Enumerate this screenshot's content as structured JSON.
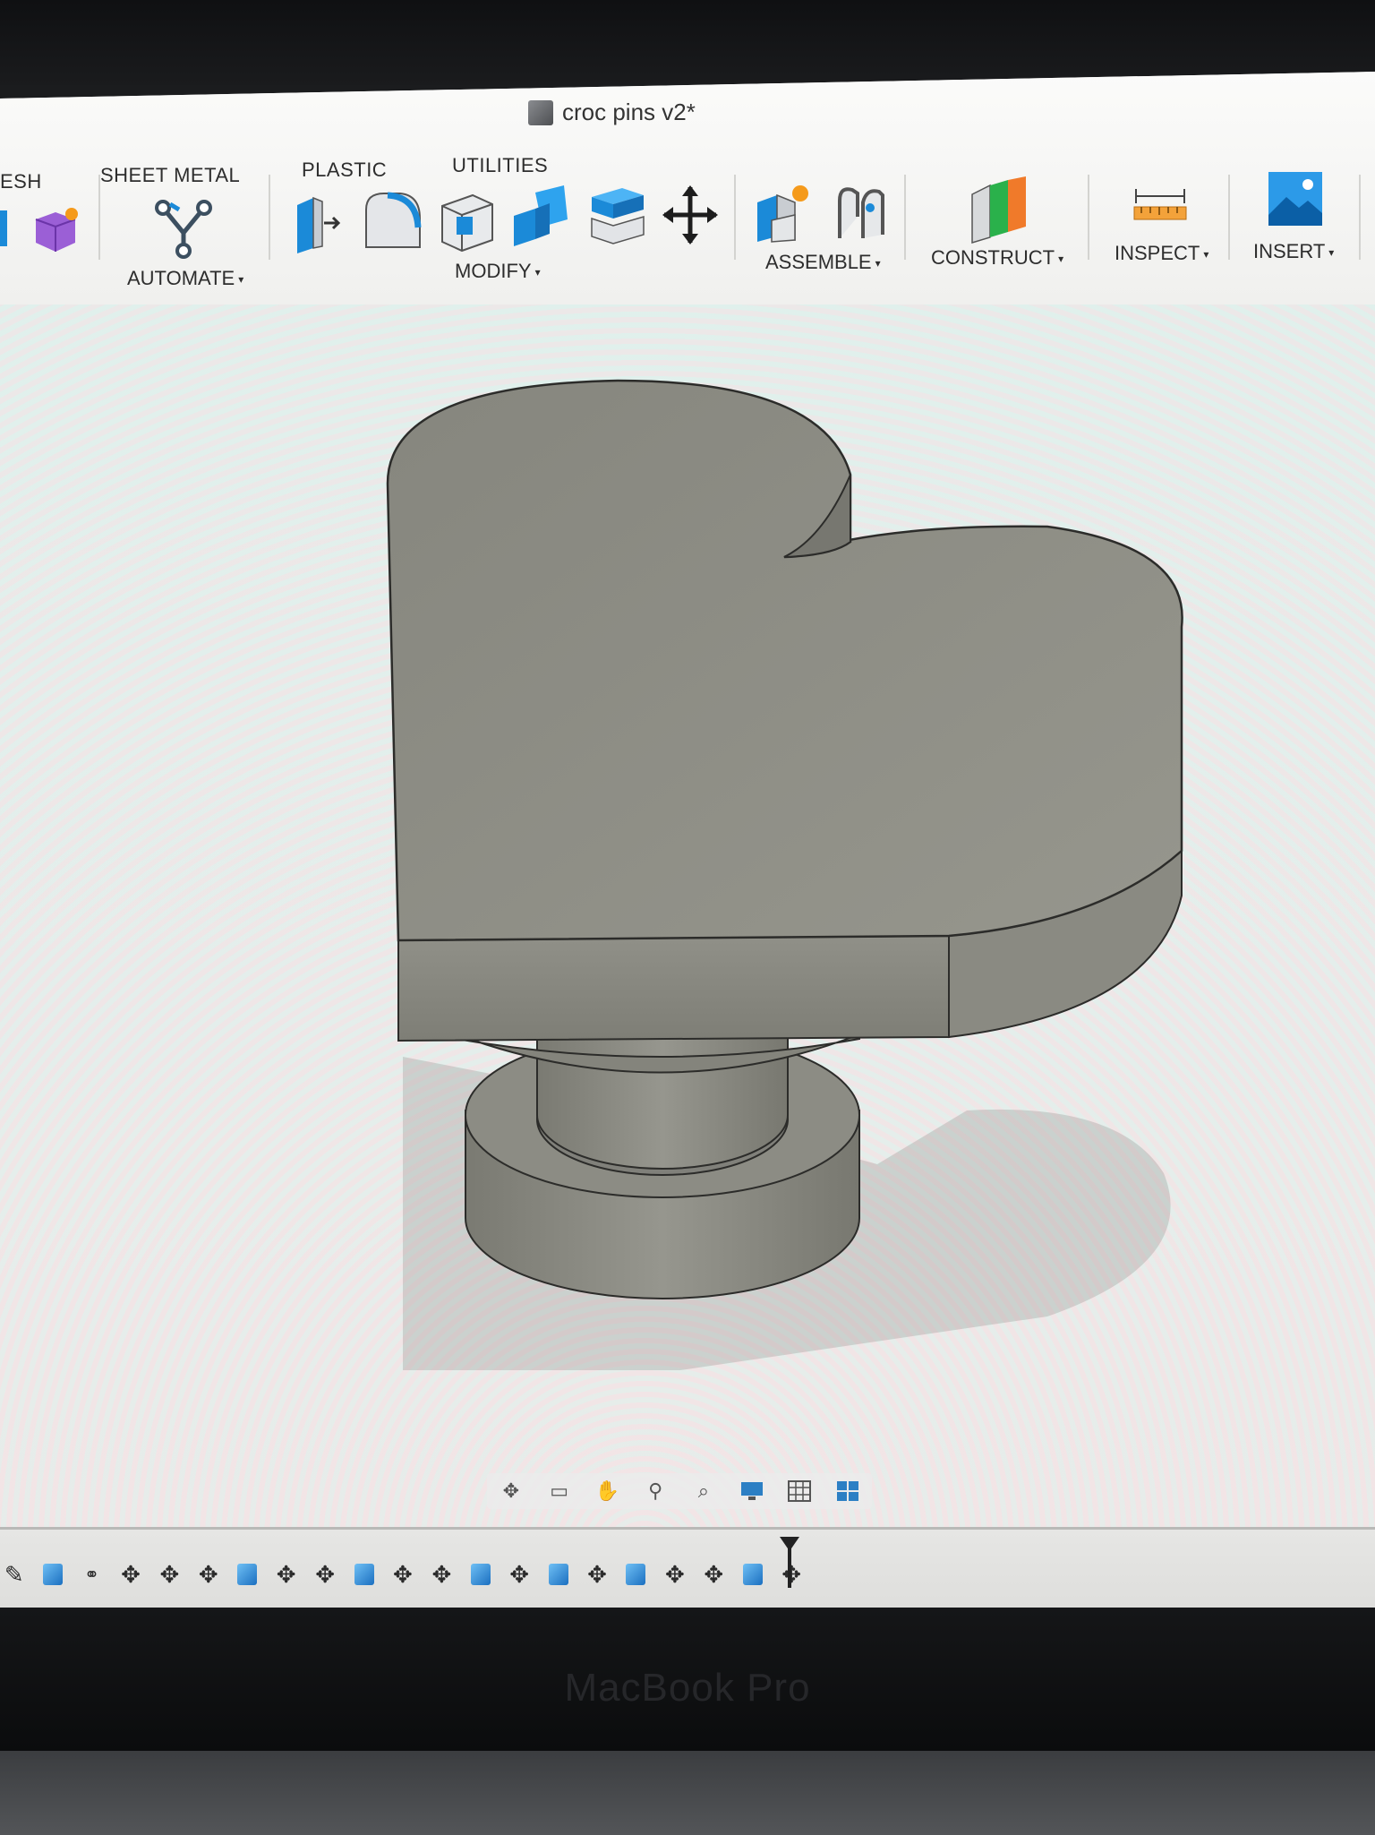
{
  "window": {
    "document_title": "croc pins v2*"
  },
  "toolbar": {
    "tabs": [
      "ESH",
      "SHEET METAL",
      "PLASTIC",
      "UTILITIES"
    ],
    "groups": {
      "automate": "AUTOMATE",
      "modify": "MODIFY",
      "assemble": "ASSEMBLE",
      "construct": "CONSTRUCT",
      "inspect": "INSPECT",
      "insert": "INSERT"
    },
    "caret": "▾"
  },
  "navigation": {
    "icons": [
      "orbit-icon",
      "look-at-icon",
      "pan-icon",
      "zoom-icon",
      "fit-icon",
      "display-settings-icon",
      "grid-icon",
      "viewports-icon"
    ]
  },
  "timeline": {
    "items": [
      "sketch",
      "body",
      "joint",
      "move",
      "move",
      "move",
      "body",
      "move",
      "move",
      "body",
      "move",
      "move",
      "body",
      "move",
      "body",
      "move",
      "body",
      "move",
      "move",
      "body",
      "move"
    ]
  },
  "device": {
    "brand_label": "MacBook Pro"
  },
  "colors": {
    "accent_blue": "#1b8ad8",
    "model_gray": "#8a8a82",
    "toolbar_bg": "#f7f7f5"
  }
}
